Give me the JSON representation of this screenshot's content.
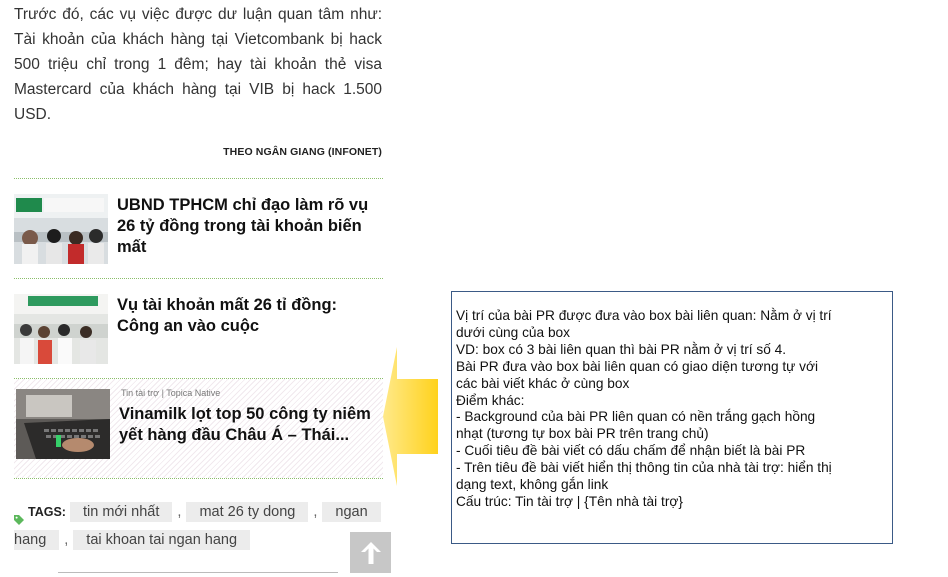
{
  "article": {
    "paragraph": "Trước đó, các vụ việc được dư luận quan tâm như: Tài khoản của khách hàng tại Vietcombank bị hack 500 triệu chỉ trong 1 đêm; hay tài khoản thẻ visa Mastercard của khách hàng tại VIB bị hack 1.500 USD.",
    "source": "THEO NGÂN GIANG (INFONET)"
  },
  "related": [
    {
      "title": "UBND TPHCM chỉ đạo làm rõ vụ 26 tỷ đồng trong tài khoản biến mất"
    },
    {
      "title": "Vụ tài khoản mất 26 tỉ đồng: Công an vào cuộc"
    }
  ],
  "pr_item": {
    "sponsor": "Tin tài trợ | Topica Native",
    "title": "Vinamilk lọt top 50 công ty niêm yết hàng đầu Châu Á – Thái..."
  },
  "tags": {
    "label": "TAGS:",
    "items": [
      "tin mới nhất",
      "mat 26 ty dong",
      "ngan",
      "hang",
      "tai khoan tai ngan hang"
    ]
  },
  "annotation": {
    "lines": [
      "Vị trí của bài PR được đưa vào box bài liên quan: Nằm ở vị trí",
      "dưới cùng của box",
      "VD: box có 3 bài liên quan thì bài PR nằm ở vị trí số 4.",
      "Bài PR đưa vào box bài liên quan có giao diện tương tự với",
      "các bài viết khác ở cùng box",
      "Điểm khác:",
      "- Background của bài PR liên quan có nền trắng gạch hồng",
      "nhạt (tương tự box bài PR trên trang chủ)",
      "- Cuối tiêu đề bài viết có dấu chấm để nhận biết là bài PR",
      "- Trên tiêu đề bài viết hiển thị thông tin của nhà tài trợ: hiển thị",
      "dạng text, không gắn link",
      "Cấu trúc: Tin tài trợ | {Tên nhà tài trợ}"
    ]
  },
  "icons": {
    "tag": "tag-icon",
    "scroll_top": "arrow-up-icon",
    "callout": "arrow-left-callout"
  },
  "colors": {
    "divider": "#8bbf6a",
    "tag_icon": "#5cb85c",
    "arrow_fill": "#ffd84a",
    "annotation_border": "#3b5a86",
    "pr_stripe": "#f1e9ee"
  }
}
